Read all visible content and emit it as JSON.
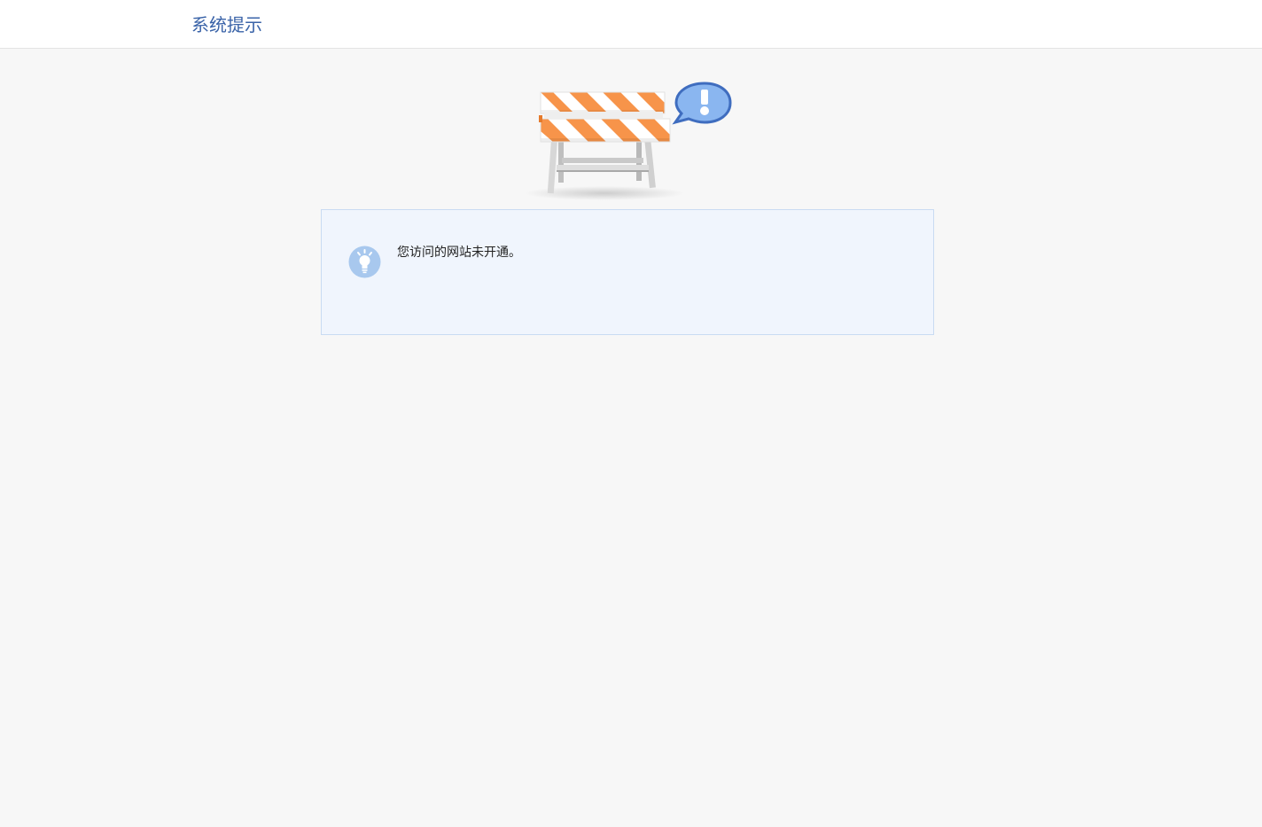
{
  "header": {
    "title": "系统提示"
  },
  "illustration": {
    "icon": "road-barrier-with-exclamation-bubble-icon",
    "colors": {
      "stripe_orange": "#f7944a",
      "bubble_blue": "#8ab6f0",
      "bubble_border": "#3f6dbf"
    }
  },
  "notice": {
    "icon": "lightbulb-icon",
    "message": "您访问的网站未开通。",
    "colors": {
      "background": "#f0f5fd",
      "border": "#c9dbf2",
      "icon_circle": "#a8c8ee"
    }
  }
}
